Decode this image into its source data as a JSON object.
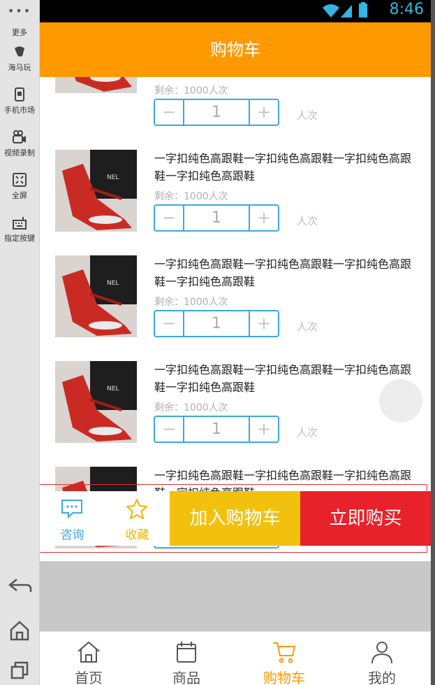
{
  "emulator": {
    "menu_dots": "•••",
    "items": [
      {
        "label": "更多"
      },
      {
        "label": "海马玩"
      },
      {
        "label": "手机市场"
      },
      {
        "label": "视频录制"
      },
      {
        "label": "全屏"
      },
      {
        "label": "指定按键"
      }
    ]
  },
  "status": {
    "time": "8:46"
  },
  "header": {
    "title": "购物车"
  },
  "items": [
    {
      "name": "",
      "remain": "剩余：1000人次",
      "qty": "1",
      "unit": "人次"
    },
    {
      "name": "一字扣纯色高跟鞋一字扣纯色高跟鞋一字扣纯色高跟鞋一字扣纯色高跟鞋",
      "remain": "剩余：1000人次",
      "qty": "1",
      "unit": "人次"
    },
    {
      "name": "一字扣纯色高跟鞋一字扣纯色高跟鞋一字扣纯色高跟鞋一字扣纯色高跟鞋",
      "remain": "剩余：1000人次",
      "qty": "1",
      "unit": "人次"
    },
    {
      "name": "一字扣纯色高跟鞋一字扣纯色高跟鞋一字扣纯色高跟鞋一字扣纯色高跟鞋",
      "remain": "剩余：1000人次",
      "qty": "1",
      "unit": "人次"
    },
    {
      "name": "一字扣纯色高跟鞋一字扣纯色高跟鞋一字扣纯色高跟鞋一字扣纯色高跟鞋",
      "remain": "",
      "qty": "",
      "unit": ""
    }
  ],
  "actions": {
    "consult": "咨询",
    "favorite": "收藏",
    "add_to_cart": "加入购物车",
    "buy_now": "立即购买"
  },
  "tabs": [
    {
      "label": "首页"
    },
    {
      "label": "商品"
    },
    {
      "label": "购物车"
    },
    {
      "label": "我的"
    }
  ],
  "colors": {
    "header": "#ff9900",
    "stepper_border": "#3ca7e3",
    "cart_button": "#f2c10d",
    "buy_button": "#e8222b",
    "tab_active": "#ff9900"
  }
}
